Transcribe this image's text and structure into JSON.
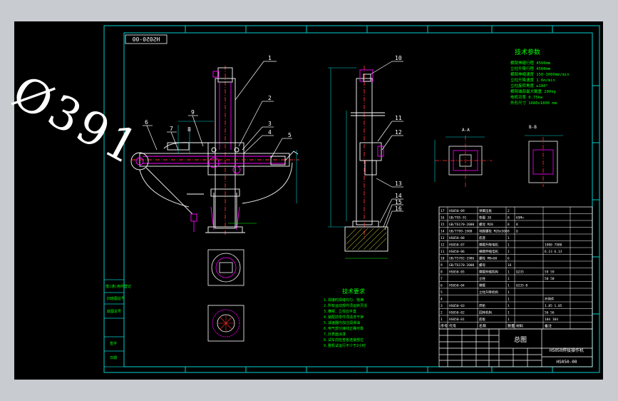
{
  "drawing": {
    "stamp": "HS050-00",
    "dimension_label": "Ø391",
    "tech_params_title": "技术参数",
    "tech_params": [
      "横臂伸缩行程  4500mm",
      "立柱升降行程  4500mm",
      "横臂伸缩速度  150-3000mm/min",
      "立柱升降速度  1.6m/min",
      "立柱旋转角度  ±180°",
      "横臂端部最大载重  200kg",
      "电机功率  0.75kw",
      "外形尺寸  1680x1800 mm"
    ],
    "tech_req_title": "技术要求",
    "tech_req": [
      "1.焊接时焊缝均匀、饱满",
      "2.所有运动部件须运转灵活",
      "3.横臂、立柱应平直",
      "4.装配前零件须清洗干净",
      "5.减速器内加注润滑油",
      "6.电气部分接线正确可靠",
      "7.外表面涂漆",
      "8.试车前检查各连接部位",
      "9.整机试运行不少于2小时"
    ],
    "callouts": [
      "1",
      "2",
      "3",
      "4",
      "5",
      "6",
      "7",
      "8",
      "9",
      "10",
      "11",
      "12",
      "13",
      "14",
      "15",
      "16"
    ],
    "section_label": "A-A",
    "section_label2": "B-B",
    "bom_rows": [
      [
        "17",
        "HS050-09",
        "弹簧压板",
        "2",
        "",
        ""
      ],
      [
        "16",
        "GB/T95-91",
        "垫圈 20",
        "8",
        "65Mn",
        ""
      ],
      [
        "15",
        "GB/T6170-2000",
        "螺母 M20",
        "8",
        "8",
        ""
      ],
      [
        "14",
        "GB/T799-1988",
        "地脚螺栓 M20x500",
        "8",
        "Q",
        ""
      ],
      [
        "13",
        "HS050-08",
        "底座",
        "1",
        "",
        ""
      ],
      [
        "12",
        "HS050-07",
        "横臂升降电机",
        "1",
        "",
        "1980 7980"
      ],
      [
        "11",
        "HS050-06",
        "横臂伸缩电机",
        "1",
        "",
        "6.13 6.13"
      ],
      [
        "10",
        "GB/T5782-1986",
        "螺栓 M8x60",
        "6",
        "",
        ""
      ],
      [
        "9",
        "GB/T6170-2000",
        "螺母",
        "16",
        "",
        ""
      ],
      [
        "8",
        "HS050-05",
        "横臂伸缩机构",
        "1",
        "Q235",
        "59 59"
      ],
      [
        "7",
        "",
        "立柱",
        "1",
        "",
        "50 50"
      ],
      [
        "6",
        "HS050-04",
        "横臂",
        "1",
        "Q235-B",
        ""
      ],
      [
        "5",
        "",
        "立柱升降机构",
        "1",
        "",
        ""
      ],
      [
        "4",
        "",
        "",
        "1",
        "",
        "外购件"
      ],
      [
        "3",
        "HS050-03",
        "焊枪",
        "1",
        "",
        "1.85 1.85"
      ],
      [
        "2",
        "HS050-02",
        "回转机构",
        "1",
        "",
        "56 56"
      ],
      [
        "1",
        "HS050-01",
        "底板",
        "1",
        "",
        "104 104"
      ]
    ],
    "bom_header": [
      "序号",
      "代号",
      "名称",
      "数量",
      "材料",
      "备注"
    ],
    "title_block": {
      "name": "总图",
      "product": "HS050焊接操作机",
      "drawing_no": "HS050-00"
    },
    "side_labels": [
      "借(通)用件登记",
      "旧底图总号",
      "底图总号",
      "签字",
      "日期"
    ]
  },
  "colors": {
    "background": "#000000",
    "frame": "#00d0d0",
    "geometry": "#ffffff",
    "text": "#00ff00",
    "highlight": "#ff00ff",
    "centerline": "#ff3030",
    "hatch": "#ffff40"
  }
}
